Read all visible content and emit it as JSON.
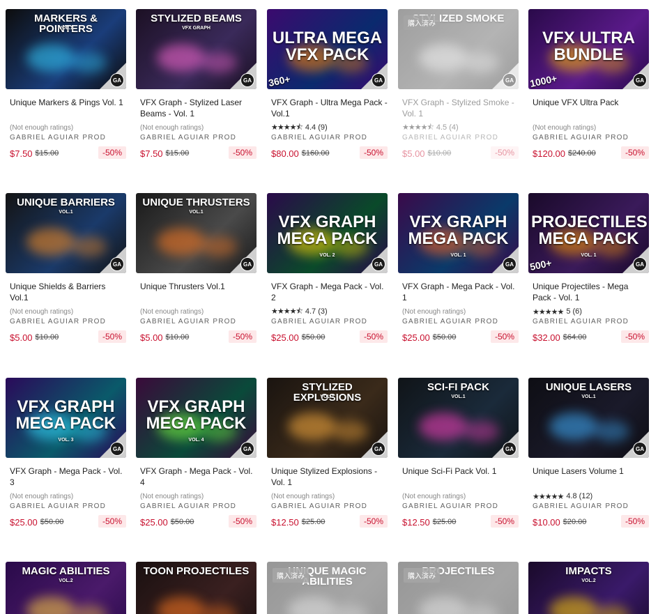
{
  "owned_label": "購入済み",
  "logo_text": "GA",
  "cards": [
    {
      "thumb_title": "MARKERS & POINTERS",
      "thumb_sub": "VOL.1",
      "count": "",
      "name": "Unique Markers & Pings Vol. 1",
      "rating_text": "(Not enough ratings)",
      "stars": "",
      "rating": "",
      "publisher": "GABRIEL AGUIAR PROD",
      "price": "$7.50",
      "original_price": "$15.00",
      "discount": "-50%",
      "owned": false,
      "colors": [
        "#0d0d0d",
        "#1a3d7a",
        "#35d0ff"
      ]
    },
    {
      "thumb_title": "STYLIZED BEAMS",
      "thumb_sub": "VFX GRAPH",
      "count": "",
      "name": "VFX Graph - Stylized Laser Beams - Vol. 1",
      "rating_text": "(Not enough ratings)",
      "stars": "",
      "rating": "",
      "publisher": "GABRIEL AGUIAR PROD",
      "price": "$7.50",
      "original_price": "$15.00",
      "discount": "-50%",
      "owned": false,
      "colors": [
        "#1c1024",
        "#3a2a5a",
        "#ff6ad5"
      ]
    },
    {
      "thumb_title": "ULTRA MEGA VFX PACK",
      "thumb_sub": "",
      "count": "360+",
      "name": "VFX Graph - Ultra Mega Pack - Vol.1",
      "rating_text": "",
      "stars": "★★★★⯪",
      "rating": "4.4 (9)",
      "publisher": "GABRIEL AGUIAR PROD",
      "price": "$80.00",
      "original_price": "$160.00",
      "discount": "-50%",
      "owned": false,
      "colors": [
        "#3b0a6e",
        "#0a2a6e",
        "#ff8a00"
      ]
    },
    {
      "thumb_title": "STYLIZED SMOKE",
      "thumb_sub": "",
      "count": "",
      "name": "VFX Graph - Stylized Smoke - Vol. 1",
      "rating_text": "",
      "stars": "★★★★⯪",
      "rating": "4.5 (4)",
      "publisher": "GABRIEL AGUIAR PROD",
      "price": "$5.00",
      "original_price": "$10.00",
      "discount": "-50%",
      "owned": true,
      "colors": [
        "#2a2a2a",
        "#5a5a5a",
        "#e0e0e0"
      ]
    },
    {
      "thumb_title": "VFX ULTRA BUNDLE",
      "thumb_sub": "",
      "count": "1000+",
      "name": "Unique VFX Ultra Pack",
      "rating_text": "(Not enough ratings)",
      "stars": "",
      "rating": "",
      "publisher": "GABRIEL AGUIAR PROD",
      "price": "$120.00",
      "original_price": "$240.00",
      "discount": "-50%",
      "owned": false,
      "colors": [
        "#2a0a4a",
        "#5a1a8a",
        "#ffb800"
      ]
    },
    {
      "thumb_title": "UNIQUE BARRIERS",
      "thumb_sub": "VOL.1",
      "count": "",
      "name": "Unique Shields & Barriers Vol.1",
      "rating_text": "(Not enough ratings)",
      "stars": "",
      "rating": "",
      "publisher": "GABRIEL AGUIAR PROD",
      "price": "$5.00",
      "original_price": "$10.00",
      "discount": "-50%",
      "owned": false,
      "colors": [
        "#141414",
        "#1a3a6a",
        "#ff9020"
      ]
    },
    {
      "thumb_title": "UNIQUE THRUSTERS",
      "thumb_sub": "VOL.1",
      "count": "",
      "name": "Unique Thrusters Vol.1",
      "rating_text": "(Not enough ratings)",
      "stars": "",
      "rating": "",
      "publisher": "GABRIEL AGUIAR PROD",
      "price": "$5.00",
      "original_price": "$10.00",
      "discount": "-50%",
      "owned": false,
      "colors": [
        "#1a1a1a",
        "#4a4a4a",
        "#ff7a20"
      ]
    },
    {
      "thumb_title": "VFX GRAPH MEGA PACK",
      "thumb_sub": "VOL. 2",
      "count": "",
      "name": "VFX Graph - Mega Pack - Vol. 2",
      "rating_text": "",
      "stars": "★★★★⯪",
      "rating": "4.7 (3)",
      "publisher": "GABRIEL AGUIAR PROD",
      "price": "$25.00",
      "original_price": "$50.00",
      "discount": "-50%",
      "owned": false,
      "colors": [
        "#2a0a4a",
        "#0a4a2a",
        "#ffe000"
      ]
    },
    {
      "thumb_title": "VFX GRAPH MEGA PACK",
      "thumb_sub": "VOL. 1",
      "count": "",
      "name": "VFX Graph - Mega Pack - Vol. 1",
      "rating_text": "(Not enough ratings)",
      "stars": "",
      "rating": "",
      "publisher": "GABRIEL AGUIAR PROD",
      "price": "$25.00",
      "original_price": "$50.00",
      "discount": "-50%",
      "owned": false,
      "colors": [
        "#3a0a4a",
        "#0a3a6a",
        "#ff6a20"
      ]
    },
    {
      "thumb_title": "PROJECTILES MEGA PACK",
      "thumb_sub": "VOL. 1",
      "count": "500+",
      "name": "Unique Projectiles - Mega Pack - Vol. 1",
      "rating_text": "",
      "stars": "★★★★★",
      "rating": "5 (6)",
      "publisher": "GABRIEL AGUIAR PROD",
      "price": "$32.00",
      "original_price": "$64.00",
      "discount": "-50%",
      "owned": false,
      "colors": [
        "#1a0a2a",
        "#3a1a5a",
        "#ff9a00"
      ]
    },
    {
      "thumb_title": "VFX GRAPH MEGA PACK",
      "thumb_sub": "VOL. 3",
      "count": "",
      "name": "VFX Graph - Mega Pack - Vol. 3",
      "rating_text": "(Not enough ratings)",
      "stars": "",
      "rating": "",
      "publisher": "GABRIEL AGUIAR PROD",
      "price": "$25.00",
      "original_price": "$50.00",
      "discount": "-50%",
      "owned": false,
      "colors": [
        "#2a0a5a",
        "#0a5a6a",
        "#35e0ff"
      ]
    },
    {
      "thumb_title": "VFX GRAPH MEGA PACK",
      "thumb_sub": "VOL. 4",
      "count": "",
      "name": "VFX Graph - Mega Pack - Vol. 4",
      "rating_text": "(Not enough ratings)",
      "stars": "",
      "rating": "",
      "publisher": "GABRIEL AGUIAR PROD",
      "price": "$25.00",
      "original_price": "$50.00",
      "discount": "-50%",
      "owned": false,
      "colors": [
        "#3a0a3a",
        "#0a4a3a",
        "#7aff40"
      ]
    },
    {
      "thumb_title": "STYLIZED EXPLOSIONS",
      "thumb_sub": "VOL.1",
      "count": "",
      "name": "Unique Stylized Explosions - Vol. 1",
      "rating_text": "(Not enough ratings)",
      "stars": "",
      "rating": "",
      "publisher": "GABRIEL AGUIAR PROD",
      "price": "$12.50",
      "original_price": "$25.00",
      "discount": "-50%",
      "owned": false,
      "colors": [
        "#1a1410",
        "#3a2a1a",
        "#ffb040"
      ]
    },
    {
      "thumb_title": "SCI-FI PACK",
      "thumb_sub": "VOL.1",
      "count": "",
      "name": "Unique Sci-Fi Pack Vol. 1",
      "rating_text": "(Not enough ratings)",
      "stars": "",
      "rating": "",
      "publisher": "GABRIEL AGUIAR PROD",
      "price": "$12.50",
      "original_price": "$25.00",
      "discount": "-50%",
      "owned": false,
      "colors": [
        "#101418",
        "#1a2a3a",
        "#ff40c0"
      ]
    },
    {
      "thumb_title": "UNIQUE LASERS",
      "thumb_sub": "VOL.1",
      "count": "",
      "name": "Unique Lasers Volume 1",
      "rating_text": "",
      "stars": "★★★★★",
      "rating": "4.8 (12)",
      "publisher": "GABRIEL AGUIAR PROD",
      "price": "$10.00",
      "original_price": "$20.00",
      "discount": "-50%",
      "owned": false,
      "colors": [
        "#0e0e14",
        "#1a1a2a",
        "#40b0ff"
      ]
    },
    {
      "thumb_title": "MAGIC ABILITIES",
      "thumb_sub": "VOL.2",
      "count": "",
      "name": "",
      "rating_text": "",
      "stars": "",
      "rating": "",
      "publisher": "",
      "price": "",
      "original_price": "",
      "discount": "",
      "owned": false,
      "colors": [
        "#2a0a4a",
        "#4a1a6a",
        "#ffd040"
      ]
    },
    {
      "thumb_title": "TOON PROJECTILES",
      "thumb_sub": "",
      "count": "",
      "name": "",
      "rating_text": "",
      "stars": "",
      "rating": "",
      "publisher": "",
      "price": "",
      "original_price": "",
      "discount": "",
      "owned": false,
      "colors": [
        "#1a1010",
        "#3a2020",
        "#ff7a20"
      ]
    },
    {
      "thumb_title": "UNIQUE MAGIC ABILITIES",
      "thumb_sub": "",
      "count": "",
      "name": "",
      "rating_text": "",
      "stars": "",
      "rating": "",
      "publisher": "",
      "price": "",
      "original_price": "",
      "discount": "",
      "owned": true,
      "colors": [
        "#1a1a1a",
        "#3a3a3a",
        "#bdbdbd"
      ]
    },
    {
      "thumb_title": "PROJECTILES",
      "thumb_sub": "",
      "count": "",
      "name": "",
      "rating_text": "",
      "stars": "",
      "rating": "",
      "publisher": "",
      "price": "",
      "original_price": "",
      "discount": "",
      "owned": true,
      "colors": [
        "#1a1a1a",
        "#3a3a3a",
        "#bdbdbd"
      ]
    },
    {
      "thumb_title": "IMPACTS",
      "thumb_sub": "VOL.2",
      "count": "",
      "name": "",
      "rating_text": "",
      "stars": "",
      "rating": "",
      "publisher": "",
      "price": "",
      "original_price": "",
      "discount": "",
      "owned": false,
      "colors": [
        "#1a0a2a",
        "#3a1a6a",
        "#ffd000"
      ]
    }
  ]
}
